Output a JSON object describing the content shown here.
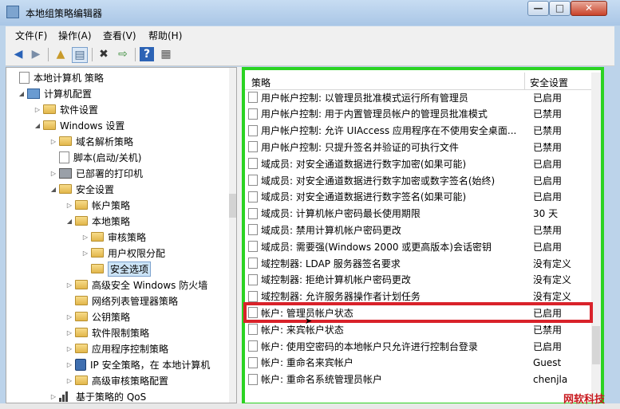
{
  "window": {
    "title": "本地组策略编辑器",
    "min_label": "—",
    "max_label": "□",
    "close_label": "✕"
  },
  "menu": [
    "文件(F)",
    "操作(A)",
    "查看(V)",
    "帮助(H)"
  ],
  "toolbar": {
    "back": "◀",
    "forward": "▶",
    "up": "▲",
    "show": "▤",
    "delete": "✖",
    "export": "⇨",
    "help": "?",
    "props": "▦"
  },
  "tree": [
    {
      "label": "本地计算机 策略",
      "icon": "doc",
      "expand": ""
    },
    {
      "label": "计算机配置",
      "icon": "computer",
      "expand": "◢"
    },
    {
      "label": "软件设置",
      "icon": "folder",
      "expand": "▷"
    },
    {
      "label": "Windows 设置",
      "icon": "folder",
      "expand": "◢"
    },
    {
      "label": "域名解析策略",
      "icon": "folder",
      "expand": "▷"
    },
    {
      "label": "脚本(启动/关机)",
      "icon": "doc",
      "expand": ""
    },
    {
      "label": "已部署的打印机",
      "icon": "printer",
      "expand": "▷"
    },
    {
      "label": "安全设置",
      "icon": "folder",
      "expand": "◢"
    },
    {
      "label": "帐户策略",
      "icon": "folder",
      "expand": "▷"
    },
    {
      "label": "本地策略",
      "icon": "folder",
      "expand": "◢"
    },
    {
      "label": "审核策略",
      "icon": "folder",
      "expand": "▷"
    },
    {
      "label": "用户权限分配",
      "icon": "folder",
      "expand": "▷"
    },
    {
      "label": "安全选项",
      "icon": "folder",
      "expand": "",
      "selected": true
    },
    {
      "label": "高级安全 Windows 防火墙",
      "icon": "folder",
      "expand": "▷"
    },
    {
      "label": "网络列表管理器策略",
      "icon": "folder",
      "expand": ""
    },
    {
      "label": "公钥策略",
      "icon": "folder",
      "expand": "▷"
    },
    {
      "label": "软件限制策略",
      "icon": "folder",
      "expand": "▷"
    },
    {
      "label": "应用程序控制策略",
      "icon": "folder",
      "expand": "▷"
    },
    {
      "label": "IP 安全策略，在 本地计算机",
      "icon": "ip",
      "expand": "▷"
    },
    {
      "label": "高级审核策略配置",
      "icon": "folder",
      "expand": "▷"
    },
    {
      "label": "基于策略的 QoS",
      "icon": "qos",
      "expand": "▷"
    }
  ],
  "list": {
    "col_policy": "策略",
    "col_setting": "安全设置",
    "rows": [
      {
        "name": "用户帐户控制: 以管理员批准模式运行所有管理员",
        "value": "已启用"
      },
      {
        "name": "用户帐户控制: 用于内置管理员帐户的管理员批准模式",
        "value": "已禁用"
      },
      {
        "name": "用户帐户控制: 允许 UIAccess 应用程序在不使用安全桌面...",
        "value": "已禁用"
      },
      {
        "name": "用户帐户控制: 只提升签名并验证的可执行文件",
        "value": "已禁用"
      },
      {
        "name": "域成员: 对安全通道数据进行数字加密(如果可能)",
        "value": "已启用"
      },
      {
        "name": "域成员: 对安全通道数据进行数字加密或数字签名(始终)",
        "value": "已启用"
      },
      {
        "name": "域成员: 对安全通道数据进行数字签名(如果可能)",
        "value": "已启用"
      },
      {
        "name": "域成员: 计算机帐户密码最长使用期限",
        "value": "30 天"
      },
      {
        "name": "域成员: 禁用计算机帐户密码更改",
        "value": "已禁用"
      },
      {
        "name": "域成员: 需要强(Windows 2000 或更高版本)会话密钥",
        "value": "已启用"
      },
      {
        "name": "域控制器: LDAP 服务器签名要求",
        "value": "没有定义"
      },
      {
        "name": "域控制器: 拒绝计算机帐户密码更改",
        "value": "没有定义"
      },
      {
        "name": "域控制器: 允许服务器操作者计划任务",
        "value": "没有定义"
      },
      {
        "name": "帐户: 管理员帐户状态",
        "value": "已启用"
      },
      {
        "name": "帐户: 来宾帐户状态",
        "value": "已禁用"
      },
      {
        "name": "帐户: 使用空密码的本地帐户只允许进行控制台登录",
        "value": "已启用"
      },
      {
        "name": "帐户: 重命名来宾帐户",
        "value": "Guest"
      },
      {
        "name": "帐户: 重命名系统管理员帐户",
        "value": "chenjla"
      }
    ]
  },
  "watermark": "网软科技"
}
